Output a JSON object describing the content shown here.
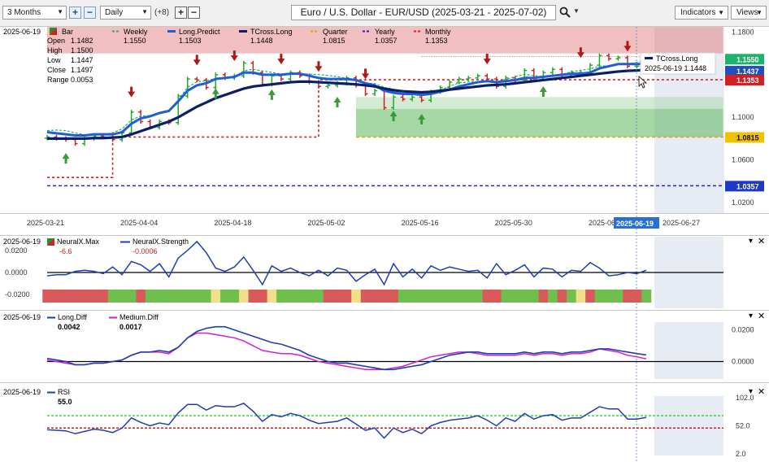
{
  "toolbar": {
    "period": "3 Months",
    "interval": "Daily",
    "plus_count": "(+8)",
    "instrument": "Euro / U.S. Dollar - EUR/USD (2025-03-21 - 2025-07-02)",
    "indicators_label": "Indicators",
    "views_label": "Views"
  },
  "main_panel": {
    "date_label": "2025-06-19",
    "legend": [
      {
        "label": "Bar",
        "color": "#2e8b2e"
      },
      {
        "label": "Weekly",
        "color": "#20b070",
        "value": "1.1550"
      },
      {
        "label": "Long.Predict",
        "color": "#1f5fd6",
        "value": "1.1503"
      },
      {
        "label": "TCross.Long",
        "color": "#0b1f66",
        "value": "1.1448"
      },
      {
        "label": "Quarter",
        "color": "#e3a318",
        "value": "1.0815"
      },
      {
        "label": "Yearly",
        "color": "#2626c8",
        "value": "1.0357"
      },
      {
        "label": "Monthly",
        "color": "#d42020",
        "value": "1.1353"
      }
    ],
    "ohlc": [
      {
        "label": "Open",
        "value": "1.1482"
      },
      {
        "label": "High",
        "value": "1.1500"
      },
      {
        "label": "Low",
        "value": "1.1447"
      },
      {
        "label": "Close",
        "value": "1.1497"
      },
      {
        "label": "Range",
        "value": "0.0053"
      }
    ],
    "tooltip": {
      "title": "TCross.Long",
      "text": "2025-06-19  1.1448"
    },
    "price_tags": [
      {
        "value": "1.1550",
        "color": "#1db36b",
        "price": 1.155
      },
      {
        "value": "1.1437",
        "color": "#1f4fc0",
        "price": 1.1437
      },
      {
        "value": "1.1353",
        "color": "#d42020",
        "price": 1.1353
      },
      {
        "value": "1.0815",
        "color": "#f2c200",
        "price": 1.0815
      },
      {
        "value": "1.0357",
        "color": "#1d39c8",
        "price": 1.0357
      }
    ],
    "y_ticks": [
      "1.1800",
      "1.1400",
      "1.1000",
      "1.0600",
      "1.0200"
    ],
    "y_tick_values": [
      1.18,
      1.14,
      1.1,
      1.06,
      1.02
    ],
    "x_ticks": [
      "2025-03-21",
      "2025-04-04",
      "2025-04-18",
      "2025-05-02",
      "2025-05-16",
      "2025-05-30",
      "2025-06-1",
      "2025-06-27"
    ],
    "cursor_date": "2025-06-19"
  },
  "neuralx_panel": {
    "date_label": "2025-06-19",
    "legend": [
      {
        "label": "NeuralX.Max",
        "value": "-6.6",
        "color": "#2e8b2e"
      },
      {
        "label": "NeuralX.Strength",
        "value": "-0.0006",
        "color": "#1f3fb0"
      }
    ],
    "y_ticks": [
      "0.0200",
      "0.0000",
      "-0.0200"
    ],
    "y_tick_values": [
      0.02,
      0.0,
      -0.02
    ]
  },
  "diff_panel": {
    "date_label": "2025-06-19",
    "legend": [
      {
        "label": "Long.Diff",
        "value": "0.0042",
        "color": "#1f3fb0"
      },
      {
        "label": "Medium.Diff",
        "value": "0.0017",
        "color": "#d020d0"
      }
    ],
    "y_ticks": [
      "0.0200",
      "0.0000"
    ],
    "y_tick_values": [
      0.02,
      0.0
    ]
  },
  "rsi_panel": {
    "date_label": "2025-06-19",
    "legend": [
      {
        "label": "RSI",
        "value": "55.0",
        "color": "#1f3fb0"
      }
    ],
    "y_ticks": [
      "102.0",
      "52.0",
      "2.0"
    ],
    "y_tick_values": [
      102,
      52,
      2
    ]
  },
  "chart_data": [
    {
      "type": "bar",
      "title": "Euro / U.S. Dollar - EUR/USD (2025-03-21 - 2025-07-02)",
      "ylim": [
        1.01,
        1.185
      ],
      "x": [
        "2025-03-21",
        "2025-03-24",
        "2025-03-25",
        "2025-03-26",
        "2025-03-27",
        "2025-03-28",
        "2025-03-31",
        "2025-04-01",
        "2025-04-02",
        "2025-04-03",
        "2025-04-04",
        "2025-04-07",
        "2025-04-08",
        "2025-04-09",
        "2025-04-10",
        "2025-04-11",
        "2025-04-14",
        "2025-04-15",
        "2025-04-16",
        "2025-04-17",
        "2025-04-18",
        "2025-04-21",
        "2025-04-22",
        "2025-04-23",
        "2025-04-24",
        "2025-04-25",
        "2025-04-28",
        "2025-04-29",
        "2025-04-30",
        "2025-05-01",
        "2025-05-02",
        "2025-05-05",
        "2025-05-06",
        "2025-05-07",
        "2025-05-08",
        "2025-05-09",
        "2025-05-12",
        "2025-05-13",
        "2025-05-14",
        "2025-05-15",
        "2025-05-16",
        "2025-05-19",
        "2025-05-20",
        "2025-05-21",
        "2025-05-22",
        "2025-05-23",
        "2025-05-26",
        "2025-05-27",
        "2025-05-28",
        "2025-05-29",
        "2025-05-30",
        "2025-06-02",
        "2025-06-03",
        "2025-06-04",
        "2025-06-05",
        "2025-06-06",
        "2025-06-09",
        "2025-06-10",
        "2025-06-11",
        "2025-06-12",
        "2025-06-13",
        "2025-06-16",
        "2025-06-17",
        "2025-06-18",
        "2025-06-19"
      ],
      "series": [
        {
          "name": "Bar (close)",
          "values": [
            1.0815,
            1.0801,
            1.0792,
            1.0753,
            1.0801,
            1.0823,
            1.0815,
            1.079,
            1.0855,
            1.105,
            1.096,
            1.0905,
            1.096,
            1.095,
            1.12,
            1.136,
            1.135,
            1.128,
            1.14,
            1.137,
            1.139,
            1.151,
            1.142,
            1.131,
            1.139,
            1.136,
            1.142,
            1.139,
            1.133,
            1.129,
            1.13,
            1.132,
            1.137,
            1.13,
            1.122,
            1.125,
            1.109,
            1.119,
            1.117,
            1.119,
            1.116,
            1.124,
            1.128,
            1.133,
            1.136,
            1.137,
            1.139,
            1.136,
            1.129,
            1.137,
            1.135,
            1.144,
            1.137,
            1.142,
            1.145,
            1.14,
            1.142,
            1.142,
            1.149,
            1.158,
            1.155,
            1.156,
            1.148,
            1.148,
            1.1497
          ]
        },
        {
          "name": "Long.Predict",
          "values": [
            1.086,
            1.085,
            1.084,
            1.083,
            1.083,
            1.084,
            1.084,
            1.084,
            1.086,
            1.094,
            1.099,
            1.101,
            1.104,
            1.106,
            1.115,
            1.125,
            1.13,
            1.132,
            1.136,
            1.137,
            1.138,
            1.142,
            1.142,
            1.14,
            1.14,
            1.14,
            1.141,
            1.141,
            1.139,
            1.137,
            1.136,
            1.136,
            1.136,
            1.135,
            1.132,
            1.13,
            1.125,
            1.123,
            1.122,
            1.122,
            1.121,
            1.122,
            1.124,
            1.126,
            1.129,
            1.131,
            1.133,
            1.134,
            1.133,
            1.134,
            1.135,
            1.137,
            1.137,
            1.138,
            1.139,
            1.14,
            1.141,
            1.141,
            1.142,
            1.146,
            1.148,
            1.15,
            1.15,
            1.15,
            1.1503
          ]
        },
        {
          "name": "TCross.Long",
          "values": [
            1.08,
            1.08,
            1.08,
            1.08,
            1.08,
            1.0805,
            1.0805,
            1.081,
            1.0815,
            1.084,
            1.087,
            1.09,
            1.093,
            1.096,
            1.1,
            1.105,
            1.11,
            1.114,
            1.118,
            1.121,
            1.124,
            1.127,
            1.129,
            1.13,
            1.131,
            1.132,
            1.133,
            1.1335,
            1.1335,
            1.133,
            1.1325,
            1.132,
            1.1315,
            1.131,
            1.13,
            1.129,
            1.127,
            1.1255,
            1.1245,
            1.124,
            1.1235,
            1.124,
            1.125,
            1.126,
            1.127,
            1.128,
            1.129,
            1.13,
            1.1305,
            1.131,
            1.132,
            1.133,
            1.134,
            1.135,
            1.136,
            1.137,
            1.138,
            1.139,
            1.14,
            1.141,
            1.142,
            1.143,
            1.1437,
            1.144,
            1.1448
          ]
        },
        {
          "name": "Quarter",
          "values": [
            1.0815
          ]
        },
        {
          "name": "Yearly",
          "values": [
            1.0357
          ]
        },
        {
          "name": "Monthly",
          "values": [
            1.0435,
            1.0435,
            1.0435,
            1.0435,
            1.0435,
            1.0435,
            1.0435,
            1.0815,
            1.0815,
            1.0815,
            1.0815,
            1.0815,
            1.0815,
            1.0815,
            1.0815,
            1.0815,
            1.0815,
            1.0815,
            1.0815,
            1.0815,
            1.0815,
            1.0815,
            1.0815,
            1.0815,
            1.0815,
            1.0815,
            1.0815,
            1.0815,
            1.0815,
            1.1353,
            1.1353,
            1.1353,
            1.1353,
            1.1353,
            1.1353,
            1.1353,
            1.1353,
            1.1353,
            1.1353,
            1.1353,
            1.1353,
            1.1353,
            1.1353,
            1.1353,
            1.1353,
            1.1353,
            1.1353,
            1.1353,
            1.1353,
            1.1353,
            1.1353,
            1.1353,
            1.1353,
            1.1353,
            1.1353,
            1.1353,
            1.1353,
            1.1353,
            1.1353,
            1.1353,
            1.1353,
            1.1353,
            1.1353,
            1.1353,
            1.1353
          ]
        }
      ]
    },
    {
      "type": "line",
      "title": "NeuralX",
      "ylim": [
        -0.028,
        0.028
      ],
      "series": [
        {
          "name": "NeuralX.Strength",
          "values": [
            -0.003,
            -0.002,
            -0.002,
            0.001,
            0.002,
            0.001,
            -0.001,
            0.005,
            -0.002,
            0.01,
            0.007,
            0.001,
            0.008,
            -0.004,
            0.013,
            0.02,
            0.028,
            0.018,
            0.004,
            0.001,
            0.005,
            0.014,
            0.002,
            -0.011,
            0.006,
            0.001,
            0.004,
            0.0,
            -0.003,
            0.002,
            -0.003,
            0.004,
            0.002,
            -0.008,
            -0.002,
            0.003,
            -0.011,
            0.008,
            -0.004,
            0.003,
            -0.005,
            0.006,
            0.002,
            0.005,
            0.003,
            0.001,
            0.002,
            -0.005,
            0.008,
            -0.002,
            0.002,
            0.007,
            -0.004,
            0.004,
            0.003,
            -0.004,
            0.002,
            0.001,
            0.009,
            0.004,
            -0.003,
            -0.002,
            0.0,
            -0.001,
            0.002
          ]
        },
        {
          "name": "NeuralX.Max",
          "values": [
            -1,
            -1,
            -1,
            -1,
            -1,
            -1,
            -1,
            1,
            1,
            1,
            -1,
            1,
            1,
            1,
            1,
            1,
            1,
            1,
            0,
            1,
            1,
            0,
            -1,
            -1,
            0,
            1,
            1,
            1,
            1,
            1,
            -1,
            -1,
            -1,
            0,
            -1,
            -1,
            -1,
            -1,
            1,
            1,
            1,
            1,
            1,
            1,
            1,
            1,
            1,
            -1,
            -1,
            1,
            1,
            1,
            1,
            -1,
            1,
            -1,
            1,
            0,
            -1,
            1,
            1,
            1,
            -1,
            -1,
            1
          ]
        }
      ]
    },
    {
      "type": "line",
      "title": "Diff",
      "ylim": [
        -0.01,
        0.028
      ],
      "series": [
        {
          "name": "Long.Diff",
          "values": [
            0.002,
            0.001,
            0.0,
            -0.002,
            -0.002,
            -0.001,
            -0.001,
            0.0,
            0.001,
            0.004,
            0.006,
            0.006,
            0.007,
            0.006,
            0.009,
            0.015,
            0.019,
            0.021,
            0.022,
            0.022,
            0.02,
            0.018,
            0.016,
            0.014,
            0.012,
            0.011,
            0.009,
            0.007,
            0.004,
            0.002,
            0.0,
            -0.001,
            -0.001,
            -0.002,
            -0.003,
            -0.004,
            -0.005,
            -0.005,
            -0.004,
            -0.003,
            -0.002,
            0.0,
            0.002,
            0.004,
            0.005,
            0.006,
            0.006,
            0.005,
            0.005,
            0.005,
            0.005,
            0.006,
            0.005,
            0.006,
            0.006,
            0.005,
            0.006,
            0.006,
            0.007,
            0.008,
            0.008,
            0.007,
            0.006,
            0.005,
            0.0042
          ]
        },
        {
          "name": "Medium.Diff",
          "values": [
            0.001,
            0.0,
            -0.001,
            -0.002,
            -0.002,
            -0.001,
            -0.001,
            0.0,
            0.001,
            0.004,
            0.006,
            0.006,
            0.006,
            0.005,
            0.009,
            0.015,
            0.018,
            0.018,
            0.017,
            0.016,
            0.015,
            0.013,
            0.01,
            0.007,
            0.006,
            0.005,
            0.005,
            0.004,
            0.002,
            0.0,
            -0.001,
            -0.002,
            -0.003,
            -0.004,
            -0.005,
            -0.005,
            -0.005,
            -0.004,
            -0.003,
            -0.001,
            0.001,
            0.003,
            0.004,
            0.005,
            0.006,
            0.006,
            0.005,
            0.004,
            0.004,
            0.004,
            0.004,
            0.005,
            0.004,
            0.005,
            0.005,
            0.004,
            0.005,
            0.005,
            0.006,
            0.008,
            0.007,
            0.006,
            0.004,
            0.003,
            0.0017
          ]
        }
      ]
    },
    {
      "type": "line",
      "title": "RSI",
      "ylim": [
        2,
        102
      ],
      "series": [
        {
          "name": "RSI",
          "values": [
            45,
            44,
            43,
            38,
            42,
            46,
            44,
            40,
            48,
            66,
            58,
            52,
            57,
            54,
            75,
            90,
            90,
            80,
            88,
            86,
            86,
            92,
            78,
            60,
            72,
            68,
            74,
            70,
            62,
            56,
            58,
            60,
            66,
            55,
            44,
            48,
            30,
            48,
            40,
            46,
            38,
            52,
            58,
            62,
            64,
            66,
            70,
            62,
            52,
            66,
            60,
            74,
            64,
            70,
            72,
            62,
            66,
            66,
            76,
            86,
            82,
            82,
            64,
            64,
            67
          ]
        }
      ]
    }
  ]
}
